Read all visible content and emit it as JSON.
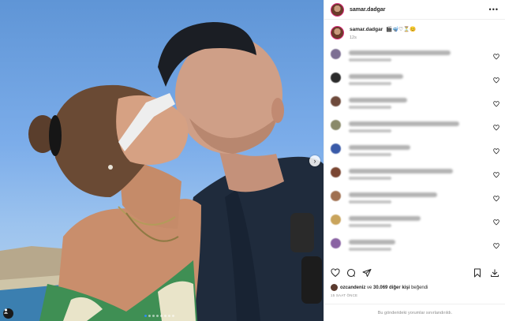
{
  "post": {
    "username": "samar.dadgar",
    "caption_emojis": "🎬🤿♡⏳😊",
    "caption_time": "12s",
    "likes_user": "ozcandeniz",
    "likes_connector": "ve",
    "likes_count": "30.069 diğer kişi",
    "likes_suffix": "beğendi",
    "time_ago": "15 SAAT ÖNCE",
    "comments_disabled": "Bu gönderideki yorumlar sınırlandırıldı.",
    "carousel_total": 8,
    "carousel_active": 1
  },
  "icons": {
    "more": "more-options-icon",
    "like": "heart-icon",
    "comment": "comment-icon",
    "share": "share-icon",
    "save": "bookmark-icon",
    "download": "download-icon",
    "next": "chevron-right-icon",
    "tag": "user-tag-icon"
  },
  "comments": [
    {
      "avatar_color": "#7d6f93",
      "w": 0.78,
      "text": "",
      "liked": false
    },
    {
      "avatar_color": "#2b2b2b",
      "w": 0.42,
      "text": "",
      "liked": false
    },
    {
      "avatar_color": "#6e4a3c",
      "w": 0.45,
      "text": "",
      "liked": false
    },
    {
      "avatar_color": "#8a8a6a",
      "w": 0.85,
      "text": "",
      "liked": false
    },
    {
      "avatar_color": "#3a5aa8",
      "w": 0.47,
      "text": "",
      "liked": false
    },
    {
      "avatar_color": "#7a4632",
      "w": 0.8,
      "text": "",
      "liked": false
    },
    {
      "avatar_color": "#a07050",
      "w": 0.68,
      "text": "",
      "liked": false
    },
    {
      "avatar_color": "#c9a45c",
      "w": 0.55,
      "text": "",
      "liked": false
    },
    {
      "avatar_color": "#8a63a3",
      "w": 0.36,
      "text": "",
      "liked": false
    }
  ],
  "colors": {
    "accent": "#0095f6",
    "text": "#262626",
    "muted": "#8e8e8e",
    "divider": "#efefef"
  }
}
